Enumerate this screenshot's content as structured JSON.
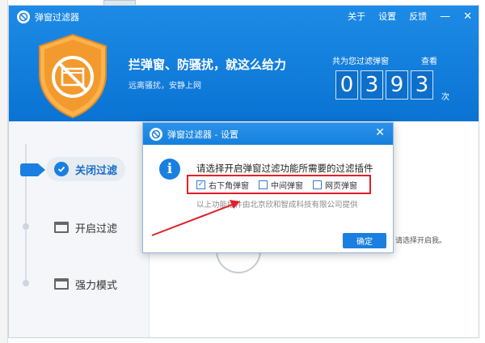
{
  "window": {
    "app_title": "弹窗过滤器",
    "menu": {
      "about": "关于",
      "settings": "设置",
      "feedback": "反馈"
    }
  },
  "header": {
    "slogan": "拦弹窗、防骚扰，就这么给力",
    "sub_slogan": "远离骚扰，安静上网",
    "count_label": "共为您过滤弹窗",
    "view_link": "查看",
    "digits": [
      "0",
      "3",
      "9",
      "3"
    ],
    "unit": "次"
  },
  "nav": {
    "items": [
      {
        "label": "关闭过滤"
      },
      {
        "label": "开启过滤"
      },
      {
        "label": "强力模式"
      }
    ]
  },
  "body": {
    "hint": "请选择开启我。"
  },
  "dialog": {
    "title": "弹窗过滤器 - 设置",
    "question": "请选择开启弹窗过滤功能所需要的过滤插件",
    "options": [
      {
        "label": "右下角弹窗",
        "checked": true
      },
      {
        "label": "中间弹窗",
        "checked": false
      },
      {
        "label": "网页弹窗",
        "checked": false
      }
    ],
    "provider": "以上功能插件由北京欣和智成科技有限公司提供",
    "ok_label": "确定"
  },
  "colors": {
    "brand_blue": "#0a73d3",
    "highlight_red": "#e0202a",
    "shield_orange": "#f5a03a"
  }
}
